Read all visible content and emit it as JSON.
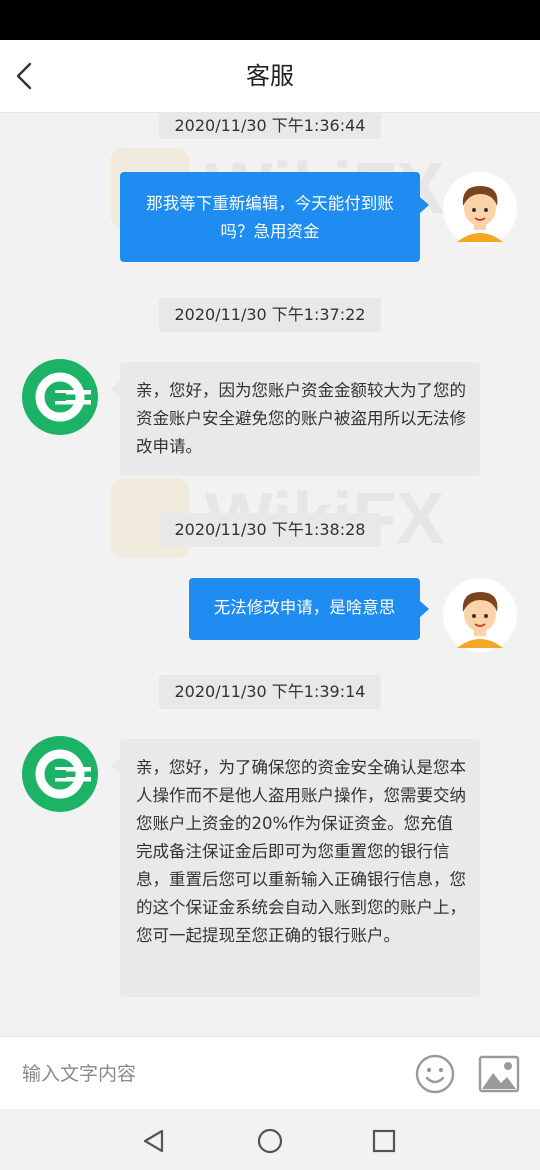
{
  "header": {
    "title": "客服"
  },
  "messages": [
    {
      "time": "2020/11/30 下午1:36:44",
      "sender": "user",
      "text": "那我等下重新编辑，今天能付到账吗？急用资金"
    },
    {
      "time": "2020/11/30 下午1:37:22",
      "sender": "service",
      "text": "亲，您好，因为您账户资金金额较大为了您的资金账户安全避免您的账户被盗用所以无法修改申请。"
    },
    {
      "time": "2020/11/30 下午1:38:28",
      "sender": "user",
      "text": "无法修改申请，是啥意思"
    },
    {
      "time": "2020/11/30 下午1:39:14",
      "sender": "service",
      "text": "亲，您好，为了确保您的资金安全确认是您本人操作而不是他人盗用账户操作，您需要交纳您账户上资金的20%作为保证资金。您充值完成备注保证金后即可为您重置您的银行信息，重置后您可以重新输入正确银行信息，您的这个保证金系统会自动入账到您的账户上，您可一起提现至您正确的银行账户。"
    }
  ],
  "input": {
    "placeholder": "输入文字内容"
  },
  "watermark": {
    "text": "WikiFX"
  },
  "icons": {
    "back": "chevron-left-icon",
    "emoji": "smiley-icon",
    "image": "image-icon",
    "nav_back": "triangle-back-icon",
    "nav_home": "circle-home-icon",
    "nav_recent": "square-recent-icon"
  },
  "colors": {
    "user_bubble": "#1e8cf0",
    "service_bubble": "#e9e9e9",
    "service_logo": "#1db366",
    "avatar_hair": "#7a4420",
    "avatar_skin": "#fcd2a9",
    "avatar_shirt": "#f5a623"
  }
}
